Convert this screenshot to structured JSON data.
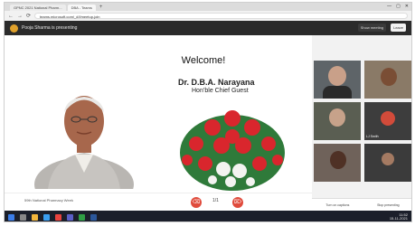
{
  "browser": {
    "tabs": [
      "GPNC 2021 National Pharm...",
      "DBA - Teams"
    ],
    "url": "teams.microsoft.com/_#/l/meetup-join",
    "window_controls": [
      "—",
      "▢",
      "✕"
    ]
  },
  "teams": {
    "meeting_title": "Pooja Sharma is presenting",
    "buttons": [
      "Show meeting",
      "Leave"
    ],
    "accent": "#d24b3a"
  },
  "slide": {
    "welcome": "Welcome!",
    "guest_name": "Dr. D.B.A. Narayana",
    "guest_role": "Hon’ble Chief Guest",
    "footer": "59th National Pharmacy Week",
    "control_left": "⌫",
    "control_mid": "1/1",
    "control_right": "⌦"
  },
  "participants": [
    {
      "name": ""
    },
    {
      "name": ""
    },
    {
      "name": ""
    },
    {
      "name": "LJ Smith"
    },
    {
      "name": ""
    },
    {
      "name": ""
    }
  ],
  "panel_bar": [
    "Turn on captions",
    "Stop presenting"
  ],
  "taskbar": {
    "time": "11:52",
    "date": "15-11-2021"
  }
}
